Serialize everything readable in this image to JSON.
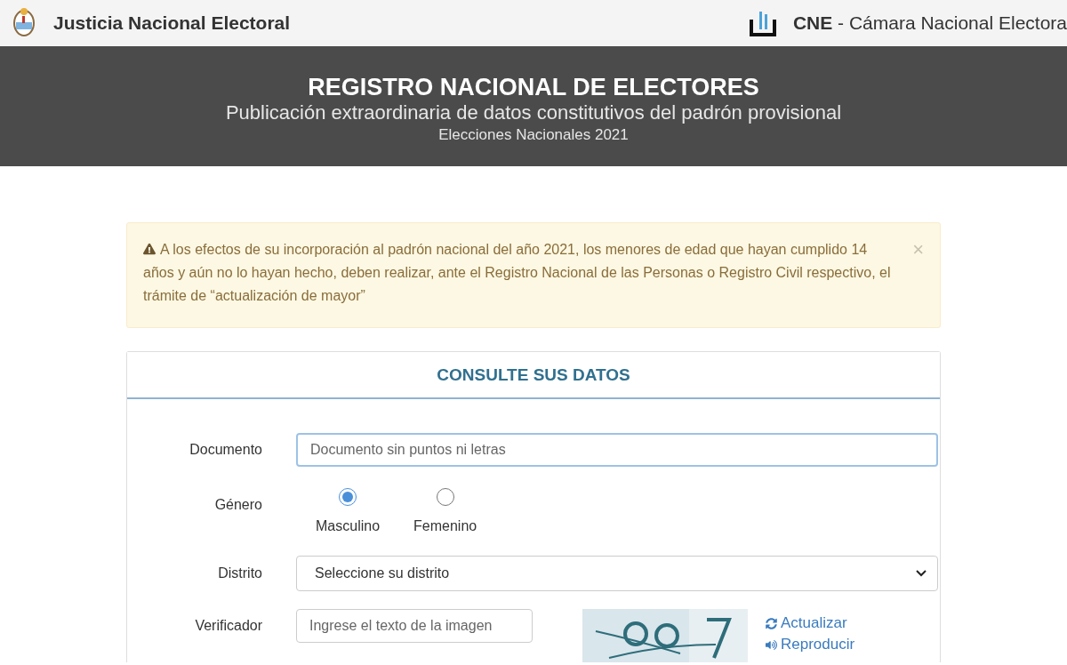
{
  "header": {
    "left_title": "Justicia Nacional Electoral",
    "right_title_bold": "CNE",
    "right_title": " - Cámara Nacional Electora"
  },
  "banner": {
    "title": "REGISTRO NACIONAL DE ELECTORES",
    "subtitle": "Publicación extraordinaria de datos constitutivos del padrón provisional",
    "caption": "Elecciones Nacionales 2021"
  },
  "alert": {
    "text": "A los efectos de su incorporación al padrón nacional del año 2021, los menores de edad que hayan cumplido 14 años y aún no lo hayan hecho, deben realizar, ante el Registro Nacional de las Personas o Registro Civil respectivo, el trámite de “actualización de mayor”",
    "close": "×"
  },
  "form": {
    "title": "CONSULTE SUS DATOS",
    "document": {
      "label": "Documento",
      "placeholder": "Documento sin puntos ni letras"
    },
    "gender": {
      "label": "Género",
      "options": [
        {
          "label": "Masculino",
          "selected": true
        },
        {
          "label": "Femenino",
          "selected": false
        }
      ]
    },
    "district": {
      "label": "Distrito",
      "value": "Seleccione su distrito"
    },
    "verifier": {
      "label": "Verificador",
      "placeholder": "Ingrese el texto de la imagen",
      "links": [
        {
          "kind": "refresh",
          "label": "Actualizar"
        },
        {
          "kind": "audio",
          "label": "Reproducir"
        }
      ]
    }
  }
}
